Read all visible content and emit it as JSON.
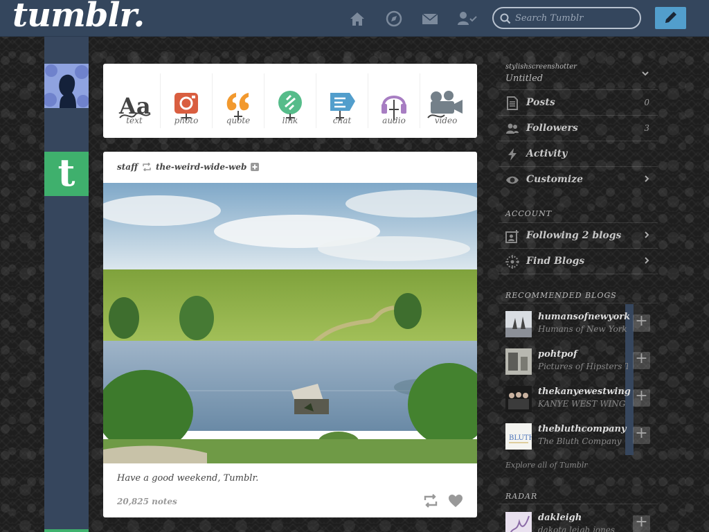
{
  "app": {
    "logo": "tumblr."
  },
  "header": {
    "nav": [
      {
        "name": "home-icon"
      },
      {
        "name": "explore-icon"
      },
      {
        "name": "inbox-icon"
      },
      {
        "name": "account-icon"
      }
    ],
    "search_placeholder": "Search Tumblr",
    "compose_icon": "pencil-icon",
    "colors": {
      "bar": "#34465d",
      "compose": "#529ecc"
    }
  },
  "post_types": [
    {
      "label": "text",
      "icon": "text-icon",
      "color": "#444444"
    },
    {
      "label": "photo",
      "icon": "photo-icon",
      "color": "#d95e40"
    },
    {
      "label": "quote",
      "icon": "quote-icon",
      "color": "#f2992e"
    },
    {
      "label": "link",
      "icon": "link-icon",
      "color": "#56bc8a"
    },
    {
      "label": "chat",
      "icon": "chat-icon",
      "color": "#529ecc"
    },
    {
      "label": "audio",
      "icon": "audio-icon",
      "color": "#a77dc2"
    },
    {
      "label": "video",
      "icon": "video-icon",
      "color": "#748089"
    }
  ],
  "post": {
    "author": "staff",
    "reblogged_from": "the-weird-wide-web",
    "caption": "Have a good weekend, Tumblr.",
    "notes": "20,825 notes"
  },
  "sidebar": {
    "blog_name": "stylishscreenshotter",
    "blog_title": "Untitled",
    "rows": [
      {
        "label": "Posts",
        "icon": "posts-icon",
        "count": "0"
      },
      {
        "label": "Followers",
        "icon": "followers-icon",
        "count": "3"
      },
      {
        "label": "Activity",
        "icon": "activity-icon",
        "count": ""
      },
      {
        "label": "Customize",
        "icon": "customize-icon",
        "count": ""
      }
    ],
    "account_heading": "ACCOUNT",
    "account_rows": [
      {
        "label": "Following 2 blogs",
        "icon": "following-icon"
      },
      {
        "label": "Find Blogs",
        "icon": "find-blogs-icon"
      }
    ],
    "recommended_heading": "RECOMMENDED BLOGS",
    "recommended": [
      {
        "name": "humansofnewyork",
        "title": "Humans of New York"
      },
      {
        "name": "pohtpof",
        "title": "Pictures of Hipsters Tak"
      },
      {
        "name": "thekanyewestwing",
        "title": "KANYE WEST WING"
      },
      {
        "name": "thebluthcompany",
        "title": "The Bluth Company"
      }
    ],
    "explore": "Explore all of Tumblr",
    "radar_heading": "RADAR",
    "radar": [
      {
        "name": "dakleigh",
        "title": "dakota leigh jones"
      }
    ]
  }
}
